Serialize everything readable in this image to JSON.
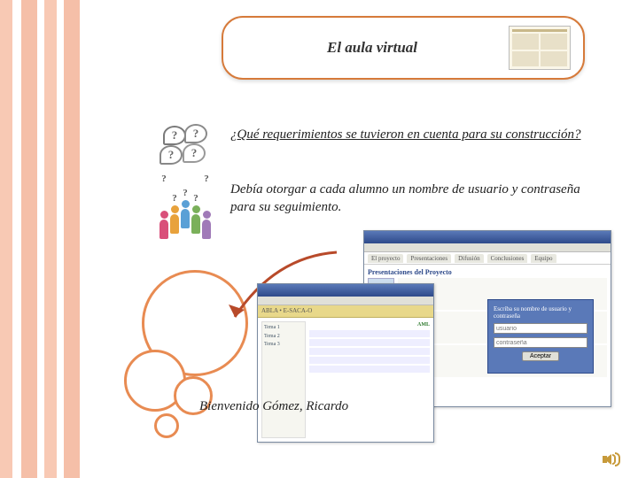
{
  "title": "El aula virtual",
  "question": "¿Qué  requerimientos se tuvieron en cuenta para su construcción?",
  "answer": "Debía otorgar a cada alumno un nombre de usuario y contraseña para su seguimiento.",
  "welcome": "Bienvenido Gómez, Ricardo",
  "login": {
    "user_label": "Escriba su nombre de usuario y contraseña",
    "user_placeholder": "usuario",
    "pass_placeholder": "contraseña",
    "button": "Aceptar"
  },
  "window_back": {
    "tabs": [
      "El proyecto",
      "Presentaciones",
      "Difusión",
      "Conclusiones",
      "Equipo"
    ],
    "section_title": "Presentaciones del Proyecto"
  },
  "window_front": {
    "header": "ABLA • E-SACA-O",
    "sidebar_items": [
      "Tema 1",
      "Tema 2",
      "Tema 3"
    ],
    "main_label": "AML"
  },
  "bubbles": {
    "q": "?"
  }
}
